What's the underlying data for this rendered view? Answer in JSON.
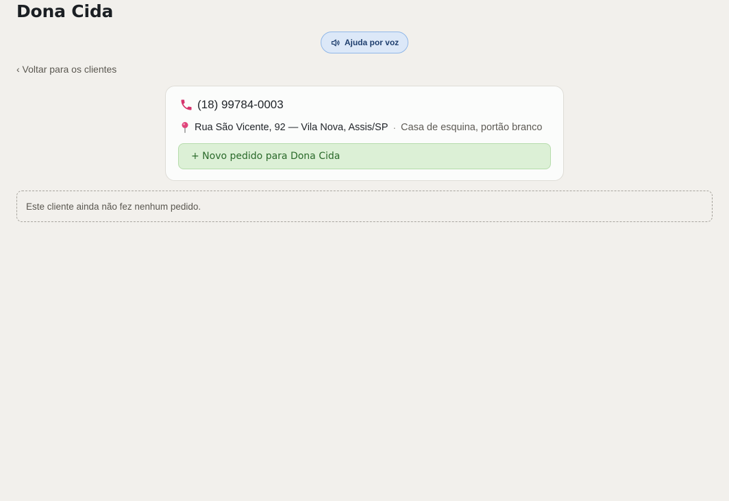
{
  "page": {
    "title": "Dona Cida"
  },
  "voice_help": {
    "label": "Ajuda por voz",
    "icon": "speaker-icon"
  },
  "nav": {
    "back_label": "‹ Voltar para os clientes"
  },
  "client_card": {
    "phone": "(18) 99784-0003",
    "phone_icon": "phone-icon",
    "address": "Rua São Vicente, 92 — Vila Nova, Assis/SP",
    "separator": "·",
    "address_note": "Casa de esquina, portão branco",
    "address_icon": "pin-icon",
    "new_order_label": "+ Novo pedido para Dona Cida"
  },
  "orders": {
    "empty_message": "Este cliente ainda não fez nenhum pedido."
  },
  "colors": {
    "background": "#f2f0ec",
    "accent_blue": "#dce8f8",
    "accent_green": "#dcf0d6",
    "phone_icon": "#d6336c",
    "pin_icon": "#e0457b"
  }
}
